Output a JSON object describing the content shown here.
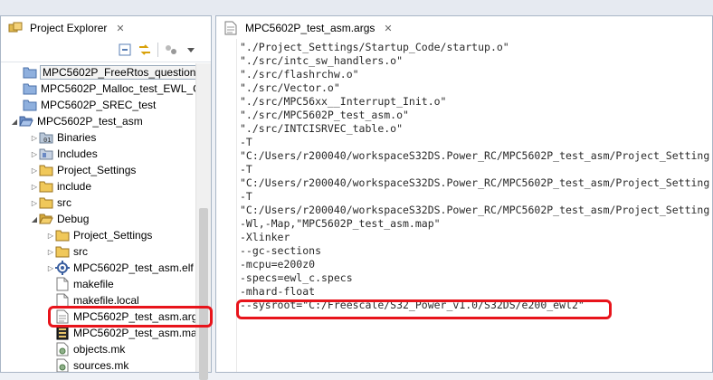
{
  "explorer": {
    "title": "Project Explorer",
    "close_glyph": "✕",
    "toolbar_icons": [
      "collapse-all-icon",
      "link-with-editor-icon",
      "filter-icon",
      "view-menu-icon"
    ],
    "items": [
      {
        "label": "MPC5602P_FreeRtos_question",
        "icon": "project-folder-icon",
        "indent": 0,
        "twisty": "",
        "selected": true
      },
      {
        "label": "MPC5602P_Malloc_test_EWL_C",
        "icon": "project-folder-icon",
        "indent": 0,
        "twisty": ""
      },
      {
        "label": "MPC5602P_SREC_test",
        "icon": "project-folder-icon",
        "indent": 0,
        "twisty": ""
      },
      {
        "label": "MPC5602P_test_asm",
        "icon": "project-folder-open-icon",
        "indent": 0,
        "twisty": "expanded"
      },
      {
        "label": "Binaries",
        "icon": "binaries-icon",
        "indent": 1,
        "twisty": "collapsed"
      },
      {
        "label": "Includes",
        "icon": "includes-icon",
        "indent": 1,
        "twisty": "collapsed"
      },
      {
        "label": "Project_Settings",
        "icon": "folder-icon",
        "indent": 1,
        "twisty": "collapsed"
      },
      {
        "label": "include",
        "icon": "folder-icon",
        "indent": 1,
        "twisty": "collapsed"
      },
      {
        "label": "src",
        "icon": "folder-icon",
        "indent": 1,
        "twisty": "collapsed"
      },
      {
        "label": "Debug",
        "icon": "folder-open-icon",
        "indent": 1,
        "twisty": "expanded"
      },
      {
        "label": "Project_Settings",
        "icon": "folder-icon",
        "indent": 2,
        "twisty": "collapsed"
      },
      {
        "label": "src",
        "icon": "folder-icon",
        "indent": 2,
        "twisty": "collapsed"
      },
      {
        "label": "MPC5602P_test_asm.elf",
        "icon": "elf-binary-icon",
        "indent": 2,
        "twisty": "collapsed"
      },
      {
        "label": "makefile",
        "icon": "file-icon",
        "indent": 2,
        "twisty": ""
      },
      {
        "label": "makefile.local",
        "icon": "file-icon",
        "indent": 2,
        "twisty": ""
      },
      {
        "label": "MPC5602P_test_asm.arg",
        "icon": "text-file-icon",
        "indent": 2,
        "twisty": ""
      },
      {
        "label": "MPC5602P_test_asm.ma",
        "icon": "map-file-icon",
        "indent": 2,
        "twisty": ""
      },
      {
        "label": "objects.mk",
        "icon": "mk-file-icon",
        "indent": 2,
        "twisty": ""
      },
      {
        "label": "sources.mk",
        "icon": "mk-file-icon",
        "indent": 2,
        "twisty": ""
      }
    ]
  },
  "editor": {
    "tab_title": "MPC5602P_test_asm.args",
    "close_glyph": "✕",
    "lines": [
      "\"./Project_Settings/Startup_Code/startup.o\"",
      "\"./src/intc_sw_handlers.o\"",
      "\"./src/flashrchw.o\"",
      "\"./src/Vector.o\"",
      "\"./src/MPC56xx__Interrupt_Init.o\"",
      "\"./src/MPC5602P_test_asm.o\"",
      "\"./src/INTCISRVEC_table.o\"",
      "-T",
      "\"C:/Users/r200040/workspaceS32DS.Power_RC/MPC5602P_test_asm/Project_Setting",
      "-T",
      "\"C:/Users/r200040/workspaceS32DS.Power_RC/MPC5602P_test_asm/Project_Setting",
      "-T",
      "\"C:/Users/r200040/workspaceS32DS.Power_RC/MPC5602P_test_asm/Project_Setting",
      "-Wl,-Map,\"MPC5602P_test_asm.map\"",
      "-Xlinker",
      "--gc-sections",
      "-mcpu=e200z0",
      "-specs=ewl_c.specs",
      "-mhard-float",
      "--sysroot=\"C:/Freescale/S32_Power_v1.0/S32DS/e200_ewl2\""
    ]
  },
  "colors": {
    "annotation": "#e8141b",
    "panel_border": "#a9b6c6",
    "folder": "#e0b94f",
    "project_folder": "#6d8fc7"
  }
}
